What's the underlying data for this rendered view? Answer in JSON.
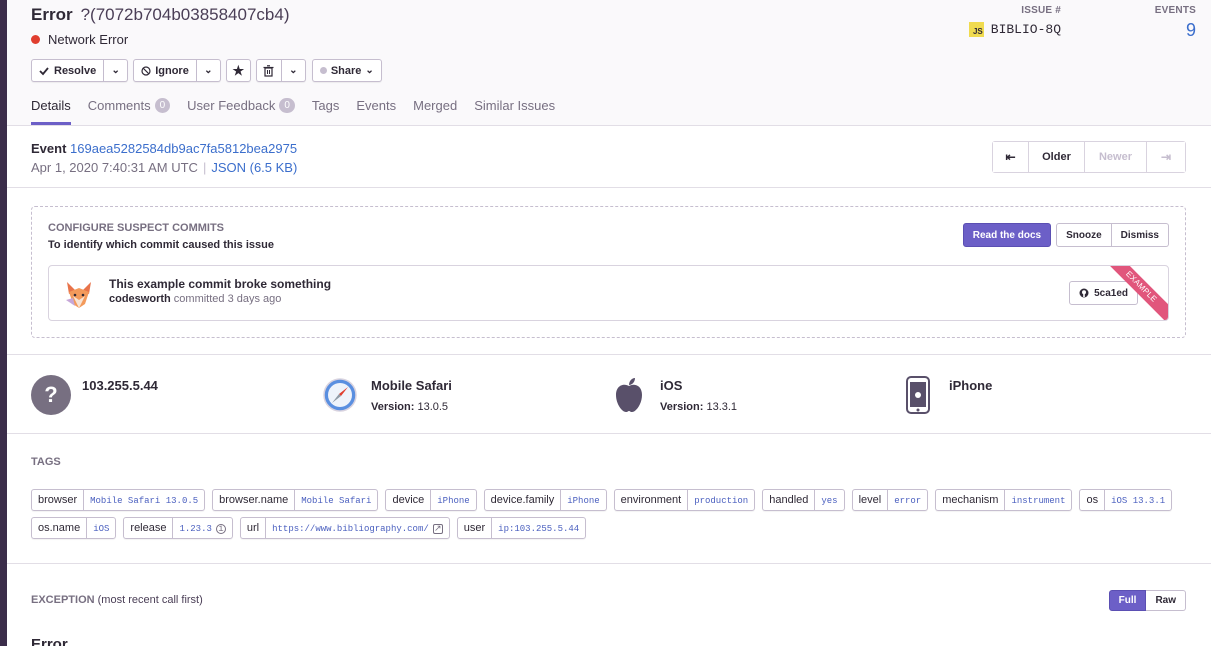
{
  "header": {
    "title": "Error",
    "event_id_short": "?(7072b704b03858407cb4)",
    "message": "Network Error",
    "issue_label": "ISSUE #",
    "issue_platform": "JS",
    "issue_id": "BIBLIO-8Q",
    "events_label": "EVENTS",
    "events_count": "9"
  },
  "actions": {
    "resolve": "Resolve",
    "ignore": "Ignore",
    "share": "Share"
  },
  "tabs": [
    {
      "label": "Details"
    },
    {
      "label": "Comments",
      "badge": "0"
    },
    {
      "label": "User Feedback",
      "badge": "0"
    },
    {
      "label": "Tags"
    },
    {
      "label": "Events"
    },
    {
      "label": "Merged"
    },
    {
      "label": "Similar Issues"
    }
  ],
  "event": {
    "label": "Event",
    "id": "169aea5282584db9ac7fa5812bea2975",
    "date": "Apr 1, 2020 7:40:31 AM UTC",
    "json": "JSON (6.5 KB)",
    "older": "Older",
    "newer": "Newer"
  },
  "suspect_commits": {
    "title": "CONFIGURE SUSPECT COMMITS",
    "subtitle": "To identify which commit caused this issue",
    "read_docs": "Read the docs",
    "snooze": "Snooze",
    "dismiss": "Dismiss",
    "commit_message": "This example commit broke something",
    "author": "codesworth",
    "committed": "committed 3 days ago",
    "sha": "5ca1ed",
    "ribbon": "EXAMPLE"
  },
  "context": {
    "user": {
      "title": "103.255.5.44"
    },
    "browser": {
      "title": "Mobile Safari",
      "version_label": "Version:",
      "version": "13.0.5"
    },
    "os": {
      "title": "iOS",
      "version_label": "Version:",
      "version": "13.3.1"
    },
    "device": {
      "title": "iPhone"
    }
  },
  "tags_section": {
    "label": "TAGS",
    "tags": [
      {
        "key": "browser",
        "value": "Mobile Safari 13.0.5"
      },
      {
        "key": "browser.name",
        "value": "Mobile Safari"
      },
      {
        "key": "device",
        "value": "iPhone"
      },
      {
        "key": "device.family",
        "value": "iPhone"
      },
      {
        "key": "environment",
        "value": "production"
      },
      {
        "key": "handled",
        "value": "yes"
      },
      {
        "key": "level",
        "value": "error"
      },
      {
        "key": "mechanism",
        "value": "instrument"
      },
      {
        "key": "os",
        "value": "iOS 13.3.1"
      },
      {
        "key": "os.name",
        "value": "iOS"
      },
      {
        "key": "release",
        "value": "1.23.3",
        "icon": "info-icon"
      },
      {
        "key": "url",
        "value": "https://www.bibliography.com/",
        "icon": "external-link-icon"
      },
      {
        "key": "user",
        "value": "ip:103.255.5.44"
      }
    ]
  },
  "exception": {
    "label": "EXCEPTION",
    "label_note": "(most recent call first)",
    "full": "Full",
    "raw": "Raw",
    "type": "Error"
  },
  "colors": {
    "accent": "#6c5fc7",
    "link": "#3b6ecc",
    "error_dot": "#e03e2f",
    "ribbon": "#e1567c"
  }
}
